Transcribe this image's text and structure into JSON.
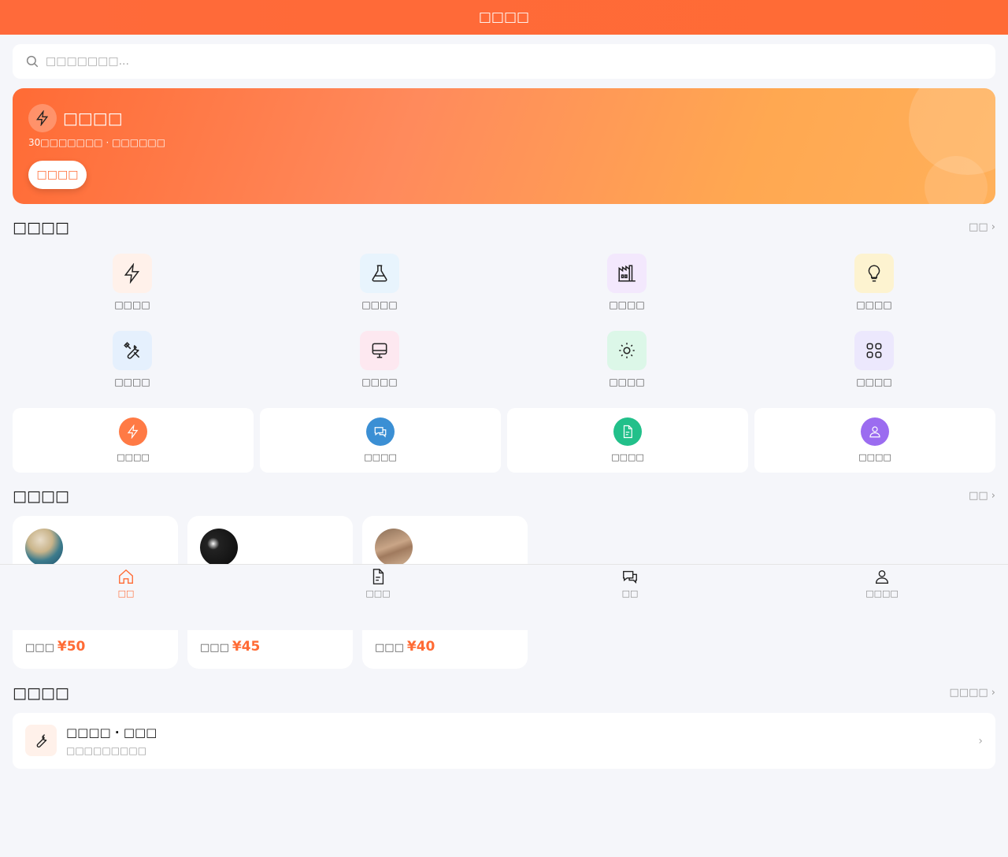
{
  "header": {
    "title": "□□□□"
  },
  "search": {
    "placeholder": "□□□□□□□..."
  },
  "banner": {
    "title": "□□□□",
    "subtitle": "30□□□□□□□ · □□□□□□",
    "button": "□□□□"
  },
  "categories_section": {
    "title": "□□□□",
    "more": "□□ ›"
  },
  "categories": [
    {
      "label": "□□□□",
      "icon": "lightning-icon",
      "bg": "#fff1ea"
    },
    {
      "label": "□□□□",
      "icon": "flask-icon",
      "bg": "#e8f4fd"
    },
    {
      "label": "□□□□",
      "icon": "factory-icon",
      "bg": "#f3e8fd"
    },
    {
      "label": "□□□□",
      "icon": "bulb-icon",
      "bg": "#fdf3d0"
    },
    {
      "label": "□□□□",
      "icon": "tools-icon",
      "bg": "#e5f0fd"
    },
    {
      "label": "□□□□",
      "icon": "monitor-icon",
      "bg": "#fde8f0"
    },
    {
      "label": "□□□□",
      "icon": "sun-icon",
      "bg": "#dcf7e8"
    },
    {
      "label": "□□□□",
      "icon": "grid-icon",
      "bg": "#ece8fd"
    }
  ],
  "quick_actions": [
    {
      "label": "□□□□",
      "icon": "lightning-icon",
      "color": "#ff7a45"
    },
    {
      "label": "□□□□",
      "icon": "chat-icon",
      "color": "#3b8fd4"
    },
    {
      "label": "□□□□",
      "icon": "document-icon",
      "color": "#22c08a"
    },
    {
      "label": "□□□□",
      "icon": "user-icon",
      "color": "#9b6cf0"
    }
  ],
  "masters_section": {
    "title": "□□□□",
    "more": "□□ ›"
  },
  "masters": [
    {
      "price_label": "□□□",
      "price": "¥50"
    },
    {
      "price_label": "□□□",
      "price": "¥45"
    },
    {
      "price_label": "□□□",
      "price": "¥40"
    }
  ],
  "bottom_nav": [
    {
      "label": "□□",
      "icon": "home-icon",
      "active": true
    },
    {
      "label": "□□□",
      "icon": "document-icon",
      "active": false
    },
    {
      "label": "□□",
      "icon": "chat-icon",
      "active": false
    },
    {
      "label": "□□□□",
      "icon": "user-icon",
      "active": false
    }
  ],
  "services_section": {
    "title": "□□□□",
    "more": "□□□□ ›"
  },
  "service": {
    "title": "□□□□ · □□□",
    "subtitle": "□□□□□□□□□",
    "icon": "wrench-icon"
  },
  "colors": {
    "accent": "#ff6b35",
    "background": "#f5f6fa"
  }
}
